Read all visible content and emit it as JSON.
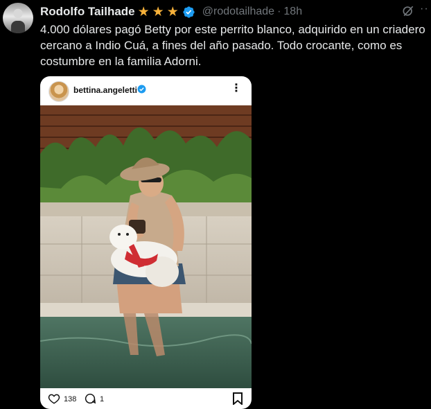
{
  "tweet": {
    "author_name": "Rodolfo Tailhade",
    "stars": [
      "★",
      "★",
      "★"
    ],
    "handle": "@rodotailhade",
    "separator": "·",
    "time": "18h",
    "more": "··",
    "text": "4.000 dólares pagó Betty por este perrito blanco, adquirido en un criadero cercano a Indio Cuá, a fines del año pasado. Todo crocante, como es costumbre en la familia Adorni."
  },
  "embed": {
    "username": "bettina.angeletti",
    "more": "⋮",
    "like_count": "138",
    "comment_count": "1"
  },
  "colors": {
    "accent": "#1d9bf0",
    "star": "#f6b13a",
    "muted": "#71767b"
  }
}
